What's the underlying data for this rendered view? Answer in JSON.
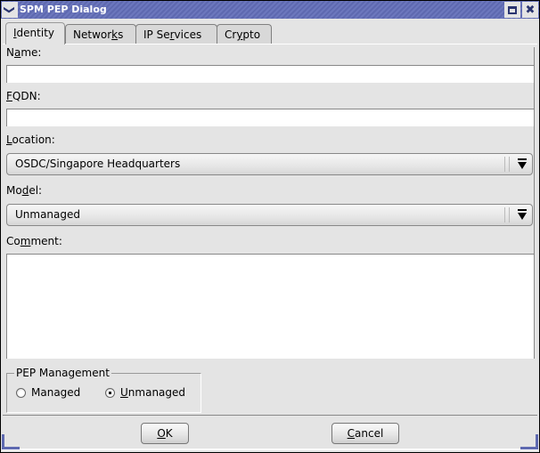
{
  "window": {
    "title": "SPM PEP Dialog",
    "menu_icon": "chevron-down-icon",
    "maximize_icon": "maximize-icon",
    "close_icon": "close-icon",
    "close_glyph": "✖",
    "menu_glyph": "❯"
  },
  "tabs": [
    {
      "pre": "",
      "mn": "I",
      "post": "dentity",
      "active": true
    },
    {
      "pre": "Networ",
      "mn": "k",
      "post": "s",
      "active": false
    },
    {
      "pre": "IP Se",
      "mn": "r",
      "post": "vices",
      "active": false
    },
    {
      "pre": "Cr",
      "mn": "y",
      "post": "pto",
      "active": false
    }
  ],
  "form": {
    "name": {
      "label_pre": "N",
      "label_mn": "a",
      "label_post": "me:",
      "value": ""
    },
    "fqdn": {
      "label_pre": "",
      "label_mn": "F",
      "label_post": "QDN:",
      "value": ""
    },
    "location": {
      "label_pre": "",
      "label_mn": "L",
      "label_post": "ocation:",
      "value": "OSDC/Singapore Headquarters"
    },
    "model": {
      "label_pre": "Mo",
      "label_mn": "d",
      "label_post": "el:",
      "value": "Unmanaged"
    },
    "comment": {
      "label_pre": "Co",
      "label_mn": "m",
      "label_post": "ment:",
      "value": ""
    }
  },
  "pep_management": {
    "legend": "PEP Management",
    "options": [
      {
        "pre": "Mana",
        "mn": "",
        "post": "ged",
        "full": "Managed",
        "checked": false
      },
      {
        "pre": "",
        "mn": "U",
        "post": "nmanaged",
        "full": "Unmanaged",
        "checked": true
      }
    ],
    "selected": "Unmanaged"
  },
  "buttons": {
    "ok": {
      "mn": "O",
      "post": "K"
    },
    "cancel": {
      "mn": "C",
      "post": "ancel"
    }
  }
}
